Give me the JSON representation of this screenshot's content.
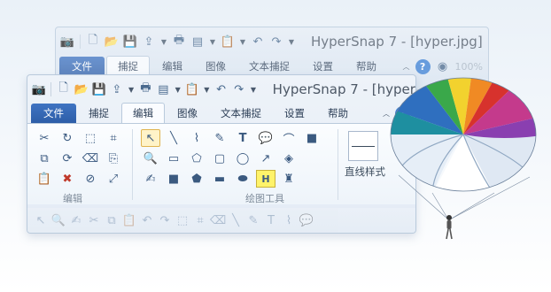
{
  "back_window": {
    "title": "HyperSnap 7 - [hyper.jpg]",
    "tabs": [
      "文件",
      "捕捉",
      "编辑",
      "图像",
      "文本捕捉",
      "设置",
      "帮助"
    ],
    "active_tab": "捕捉",
    "zoom": "100%"
  },
  "front_window": {
    "title": "HyperSnap 7 - [hyper",
    "tabs": [
      "文件",
      "捕捉",
      "编辑",
      "图像",
      "文本捕捉",
      "设置",
      "帮助"
    ],
    "active_tab": "编辑",
    "groups": {
      "edit": "编辑",
      "drawing_tools": "绘图工具",
      "line_style": "直线样式"
    },
    "highlight_text_tool": "H"
  },
  "colors": {
    "file_tab": "#2d5ea8",
    "accent_blue": "#3a7fd4",
    "active_tool_border": "#e0b450"
  },
  "icons": [
    "camera-icon",
    "new-doc-icon",
    "open-folder-icon",
    "save-icon",
    "upload-icon",
    "print-icon",
    "clipboard-icon",
    "undo-icon",
    "redo-icon",
    "help-icon",
    "parachute-illustration"
  ]
}
